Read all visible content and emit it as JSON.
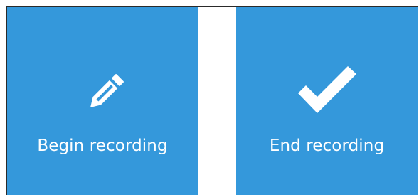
{
  "colors": {
    "tile_background": "#3498db",
    "tile_foreground": "#ffffff",
    "page_background": "#ffffff",
    "frame_border": "#2a2a2a"
  },
  "tiles": [
    {
      "label": "Begin recording",
      "icon": "pencil-icon"
    },
    {
      "label": "End recording",
      "icon": "checkmark-icon"
    }
  ]
}
